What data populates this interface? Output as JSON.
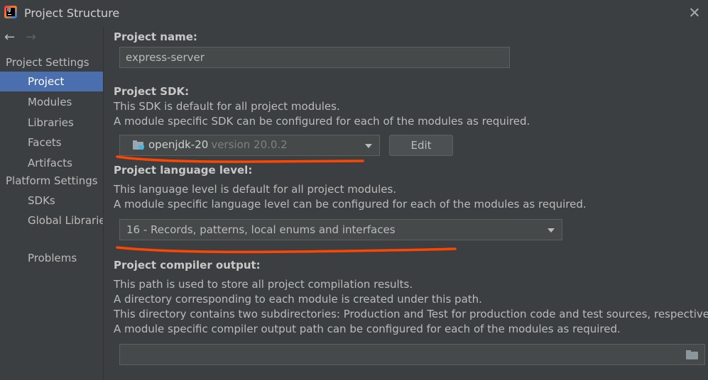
{
  "window": {
    "title": "Project Structure"
  },
  "sidebar": {
    "sections": [
      {
        "label": "Project Settings",
        "items": [
          {
            "label": "Project",
            "selected": true
          },
          {
            "label": "Modules"
          },
          {
            "label": "Libraries"
          },
          {
            "label": "Facets"
          },
          {
            "label": "Artifacts"
          }
        ]
      },
      {
        "label": "Platform Settings",
        "items": [
          {
            "label": "SDKs"
          },
          {
            "label": "Global Librarie"
          }
        ]
      }
    ],
    "problems": "Problems"
  },
  "project_name": {
    "label": "Project name:",
    "value": "express-server"
  },
  "sdk": {
    "label": "Project SDK:",
    "desc1": "This SDK is default for all project modules.",
    "desc2": "A module specific SDK can be configured for each of the modules as required.",
    "selected_name": "openjdk-20",
    "selected_version": "version 20.0.2",
    "edit_label": "Edit"
  },
  "language_level": {
    "label": "Project language level:",
    "desc1": "This language level is default for all project modules.",
    "desc2": "A module specific language level can be configured for each of the modules as required.",
    "selected": "16 - Records, patterns, local enums and interfaces"
  },
  "compiler_output": {
    "label": "Project compiler output:",
    "desc1": "This path is used to store all project compilation results.",
    "desc2": "A directory corresponding to each module is created under this path.",
    "desc3": "This directory contains two subdirectories: Production and Test for production code and test sources, respectively.",
    "desc4": "A module specific compiler output path can be configured for each of the modules as required.",
    "value": ""
  },
  "colors": {
    "selection": "#4b6eaf",
    "annotation": "#ff4500"
  },
  "icons": {
    "app": "intellij-logo-icon",
    "close": "close-icon",
    "back": "arrow-left-icon",
    "forward": "arrow-right-icon",
    "sdk": "jdk-folder-icon",
    "browse": "folder-icon"
  }
}
